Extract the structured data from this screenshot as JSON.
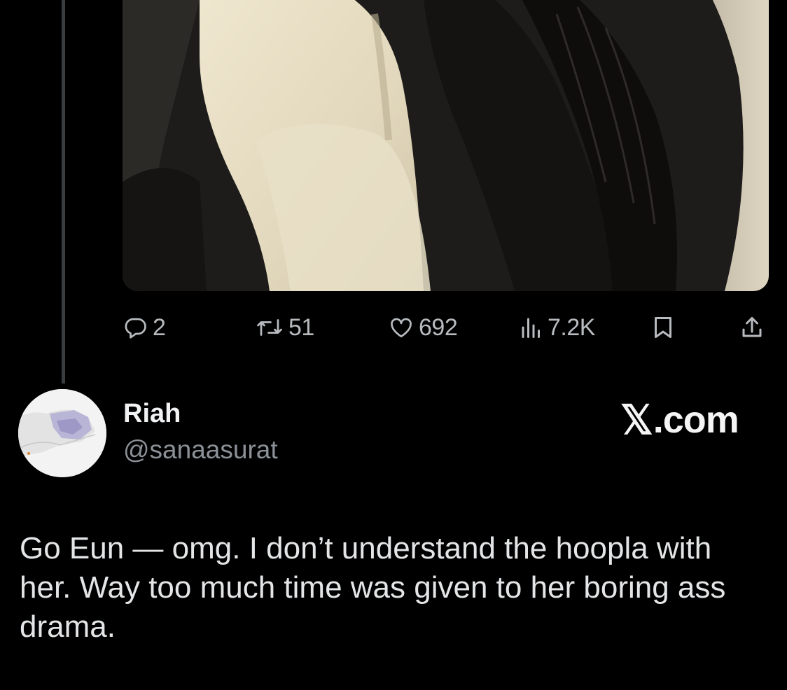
{
  "post": {
    "stats": {
      "replies": "2",
      "reposts": "51",
      "likes": "692",
      "views": "7.2K"
    }
  },
  "reply": {
    "name": "Riah",
    "handle": "@sanaasurat",
    "watermark_x": "𝕏",
    "watermark_rest": ".com",
    "text": "Go Eun — omg. I don’t understand the hoopla with her. Way too much time was given to her boring ass drama."
  },
  "icons": {
    "reply": "reply-icon",
    "repost": "repost-icon",
    "like": "heart-icon",
    "views": "views-icon",
    "bookmark": "bookmark-icon",
    "share": "share-icon"
  },
  "colors": {
    "background": "#000000",
    "text": "#e7e9ea",
    "muted": "#8b9197",
    "icon": "#b7bbbf"
  }
}
